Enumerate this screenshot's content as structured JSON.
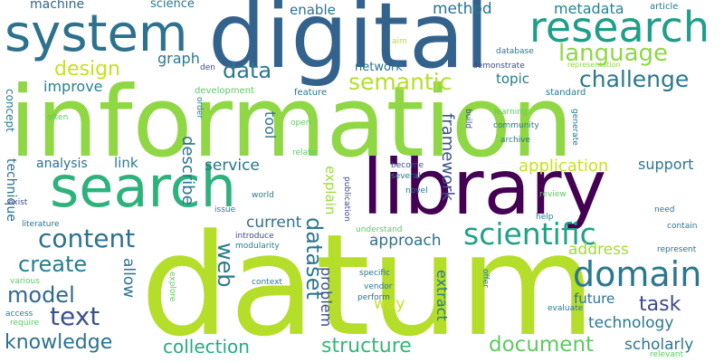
{
  "words": [
    {
      "text": "information",
      "color": "#8fd744"
    },
    {
      "text": "datum",
      "color": "#b5de2b"
    },
    {
      "text": "digital",
      "color": "#33638d"
    },
    {
      "text": "library",
      "color": "#440154"
    },
    {
      "text": "search",
      "color": "#2db27d"
    },
    {
      "text": "system",
      "color": "#2c728e"
    },
    {
      "text": "research",
      "color": "#1f9e89"
    },
    {
      "text": "language",
      "color": "#8fd744"
    },
    {
      "text": "domain",
      "color": "#2a788e"
    },
    {
      "text": "scientific",
      "color": "#1fa187"
    },
    {
      "text": "content",
      "color": "#2c728e"
    },
    {
      "text": "text",
      "color": "#3b528b"
    },
    {
      "text": "model",
      "color": "#31688e"
    },
    {
      "text": "create",
      "color": "#287d8e"
    },
    {
      "text": "knowledge",
      "color": "#2c728e"
    },
    {
      "text": "collection",
      "color": "#25ab82"
    },
    {
      "text": "structure",
      "color": "#35b779"
    },
    {
      "text": "document",
      "color": "#5ec962"
    },
    {
      "text": "challenge",
      "color": "#2a788e"
    },
    {
      "text": "semantic",
      "color": "#b5de2b"
    },
    {
      "text": "design",
      "color": "#c8e020"
    },
    {
      "text": "data",
      "color": "#2a788e"
    },
    {
      "text": "task",
      "color": "#3e4989"
    },
    {
      "text": "web",
      "color": "#2a788e"
    },
    {
      "text": "dataset",
      "color": "#2a788e"
    },
    {
      "text": "application",
      "color": "#c8e020"
    },
    {
      "text": "approach",
      "color": "#2c728e"
    },
    {
      "text": "framework",
      "color": "#3b528b"
    },
    {
      "text": "technology",
      "color": "#2a788e"
    },
    {
      "text": "scholarly",
      "color": "#2a788e"
    },
    {
      "text": "current",
      "color": "#2c728e"
    },
    {
      "text": "address",
      "color": "#a0da39"
    },
    {
      "text": "service",
      "color": "#2c728e"
    },
    {
      "text": "support",
      "color": "#2a788e"
    },
    {
      "text": "improve",
      "color": "#26828e"
    },
    {
      "text": "method",
      "color": "#2c728e"
    },
    {
      "text": "graph",
      "color": "#2a788e"
    },
    {
      "text": "metadata",
      "color": "#26828e"
    },
    {
      "text": "machine",
      "color": "#31688e"
    },
    {
      "text": "science",
      "color": "#2a788e"
    },
    {
      "text": "enable",
      "color": "#2c728e"
    },
    {
      "text": "network",
      "color": "#2c728e"
    },
    {
      "text": "topic",
      "color": "#2a788e"
    },
    {
      "text": "analysis",
      "color": "#2c728e"
    },
    {
      "text": "link",
      "color": "#2a788e"
    },
    {
      "text": "describe",
      "color": "#2c728e"
    },
    {
      "text": "allow",
      "color": "#2c728e"
    },
    {
      "text": "problem",
      "color": "#3e4989"
    },
    {
      "text": "explain",
      "color": "#a0da39"
    },
    {
      "text": "way",
      "color": "#c8e020"
    },
    {
      "text": "future",
      "color": "#2c728e"
    },
    {
      "text": "extract",
      "color": "#2a788e"
    },
    {
      "text": "technique",
      "color": "#2c728e"
    },
    {
      "text": "tool",
      "color": "#2c728e"
    },
    {
      "text": "concept",
      "color": "#2a788e"
    },
    {
      "text": "article",
      "color": "#2a788e"
    },
    {
      "text": "database",
      "color": "#2a788e"
    },
    {
      "text": "aim",
      "color": "#b5de2b"
    },
    {
      "text": "den",
      "color": "#3e4989"
    },
    {
      "text": "demonstrate",
      "color": "#3e4989"
    },
    {
      "text": "representation",
      "color": "#8fd744"
    },
    {
      "text": "development",
      "color": "#5ec962"
    },
    {
      "text": "standard",
      "color": "#2a788e"
    },
    {
      "text": "feature",
      "color": "#2c728e"
    },
    {
      "text": "order",
      "color": "#2a788e"
    },
    {
      "text": "learning",
      "color": "#5ec962"
    },
    {
      "text": "often",
      "color": "#5ec962"
    },
    {
      "text": "open",
      "color": "#5ec962"
    },
    {
      "text": "build",
      "color": "#3e4989"
    },
    {
      "text": "community",
      "color": "#2a788e"
    },
    {
      "text": "generate",
      "color": "#2a788e"
    },
    {
      "text": "archive",
      "color": "#2c728e"
    },
    {
      "text": "relate",
      "color": "#5ec962"
    },
    {
      "text": "become",
      "color": "#3e4989"
    },
    {
      "text": "several",
      "color": "#2a788e"
    },
    {
      "text": "world",
      "color": "#2a788e"
    },
    {
      "text": "publication",
      "color": "#3e4989"
    },
    {
      "text": "novel",
      "color": "#2c728e"
    },
    {
      "text": "review",
      "color": "#5ec962"
    },
    {
      "text": "exist",
      "color": "#3e4989"
    },
    {
      "text": "issue",
      "color": "#2a788e"
    },
    {
      "text": "need",
      "color": "#2a788e"
    },
    {
      "text": "literature",
      "color": "#2c728e"
    },
    {
      "text": "introduce",
      "color": "#3e4989"
    },
    {
      "text": "modularity",
      "color": "#2a788e"
    },
    {
      "text": "understand",
      "color": "#5ec962"
    },
    {
      "text": "help",
      "color": "#2a788e"
    },
    {
      "text": "contain",
      "color": "#2a788e"
    },
    {
      "text": "represent",
      "color": "#2c728e"
    },
    {
      "text": "various",
      "color": "#5ec962"
    },
    {
      "text": "context",
      "color": "#2a788e"
    },
    {
      "text": "explore",
      "color": "#5ec962"
    },
    {
      "text": "specific",
      "color": "#2c728e"
    },
    {
      "text": "vendor",
      "color": "#2a788e"
    },
    {
      "text": "offer",
      "color": "#2a788e"
    },
    {
      "text": "perform",
      "color": "#2c728e"
    },
    {
      "text": "access",
      "color": "#2a788e"
    },
    {
      "text": "require",
      "color": "#5ec962"
    },
    {
      "text": "evaluate",
      "color": "#2a788e"
    },
    {
      "text": "relevant",
      "color": "#5ec962"
    }
  ]
}
